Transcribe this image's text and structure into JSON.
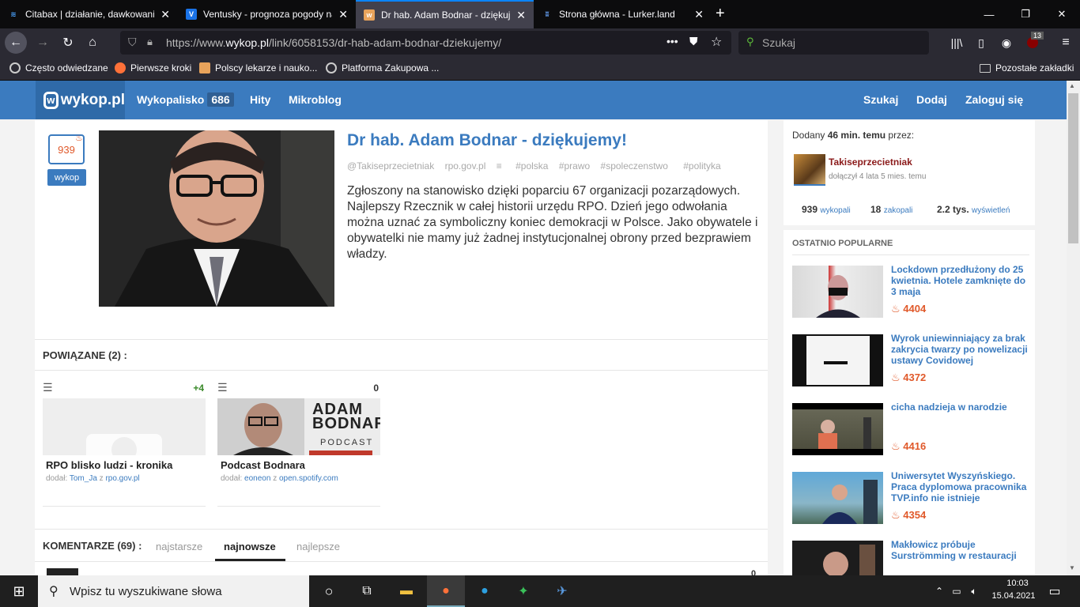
{
  "browser": {
    "tabs": [
      {
        "title": "Citabax | działanie, dawkowanie",
        "favicon": "wave-favicon",
        "active": false
      },
      {
        "title": "Ventusky - prognoza pogody na",
        "favicon": "ventusky-favicon",
        "active": false
      },
      {
        "title": "Dr hab. Adam Bodnar - dziękuj",
        "favicon": "wykop-favicon",
        "active": true
      },
      {
        "title": "Strona główna - Lurker.land",
        "favicon": "lurker-favicon",
        "active": false
      }
    ],
    "url_prefix": "https://www.",
    "url_domain": "wykop.pl",
    "url_path": "/link/6058153/dr-hab-adam-bodnar-dziekujemy/",
    "search_placeholder": "Szukaj",
    "ublock_count": "13",
    "bookmarks": [
      "Często odwiedzane",
      "Pierwsze kroki",
      "Polscy lekarze i nauko...",
      "Platforma Zakupowa ..."
    ],
    "other_bookmarks": "Pozostałe zakładki"
  },
  "site": {
    "logo": "wykop.pl",
    "nav": {
      "wykopalisko": "Wykopalisko",
      "wykopalisko_count": "686",
      "hity": "Hity",
      "mikroblog": "Mikroblog"
    },
    "nav_right": {
      "search": "Szukaj",
      "add": "Dodaj",
      "login": "Zaloguj się"
    }
  },
  "article": {
    "votes": "939",
    "vote_button": "wykop",
    "title": "Dr hab. Adam Bodnar - dziękujemy!",
    "author": "@Takiseprzecietniak",
    "source": "rpo.gov.pl",
    "tags": [
      "#polska",
      "#prawo",
      "#spoleczenstwo",
      "#polityka"
    ],
    "description": "Zgłoszony na stanowisko dzięki poparciu 67 organizacji pozarządowych. Najlepszy Rzecznik w całej historii urzędu RPO. Dzień jego odwołania można uznać za symboliczny koniec demokracji w Polsce. Jako obywatele i obywatelki nie mamy już żadnej instytucjonalnej obrony przed bezprawiem władzy."
  },
  "related": {
    "header": "POWIĄZANE (2) :",
    "items": [
      {
        "count": "+4",
        "title": "RPO blisko ludzi - kronika",
        "added_label": "dodał:",
        "user": "Tom_Ja",
        "from": "z",
        "domain": "rpo.gov.pl"
      },
      {
        "count": "0",
        "title": "Podcast Bodnara",
        "added_label": "dodał:",
        "user": "eoneon",
        "from": "z",
        "domain": "open.spotify.com",
        "img_text_1": "ADAM",
        "img_text_2": "BODNAR",
        "img_text_3": "PODCAST"
      }
    ]
  },
  "comments": {
    "header": "KOMENTARZE (69) :",
    "tabs": [
      "najstarsze",
      "najnowsze",
      "najlepsze"
    ],
    "selected": "najnowsze",
    "first_count": "0"
  },
  "sidebar": {
    "added_prefix": "Dodany",
    "added_time": "46 min. temu",
    "added_suffix": "przez:",
    "user": "Takiseprzecietniak",
    "joined": "dołączył 4 lata 5 mies. temu",
    "stats": [
      {
        "value": "939",
        "label": "wykopali"
      },
      {
        "value": "18",
        "label": "zakopali"
      },
      {
        "value": "2.2 tys.",
        "label": "wyświetleń"
      }
    ],
    "popular_header": "OSTATNIO POPULARNE",
    "popular": [
      {
        "title": "Lockdown przedłużony do 25 kwietnia. Hotele zamknięte do 3 maja",
        "score": "4404"
      },
      {
        "title": "Wyrok uniewinniający za brak zakrycia twarzy po nowelizacji ustawy Covidowej",
        "score": "4372"
      },
      {
        "title": "cicha nadzieja w narodzie",
        "score": "4416"
      },
      {
        "title": "Uniwersytet Wyszyńskiego. Praca dyplomowa pracownika TVP.info nie istnieje",
        "score": "4354"
      },
      {
        "title": "Makłowicz próbuje Surströmming w restauracji",
        "score": ""
      }
    ]
  },
  "taskbar": {
    "search_placeholder": "Wpisz tu wyszukiwane słowa",
    "time": "10:03",
    "date": "15.04.2021"
  }
}
